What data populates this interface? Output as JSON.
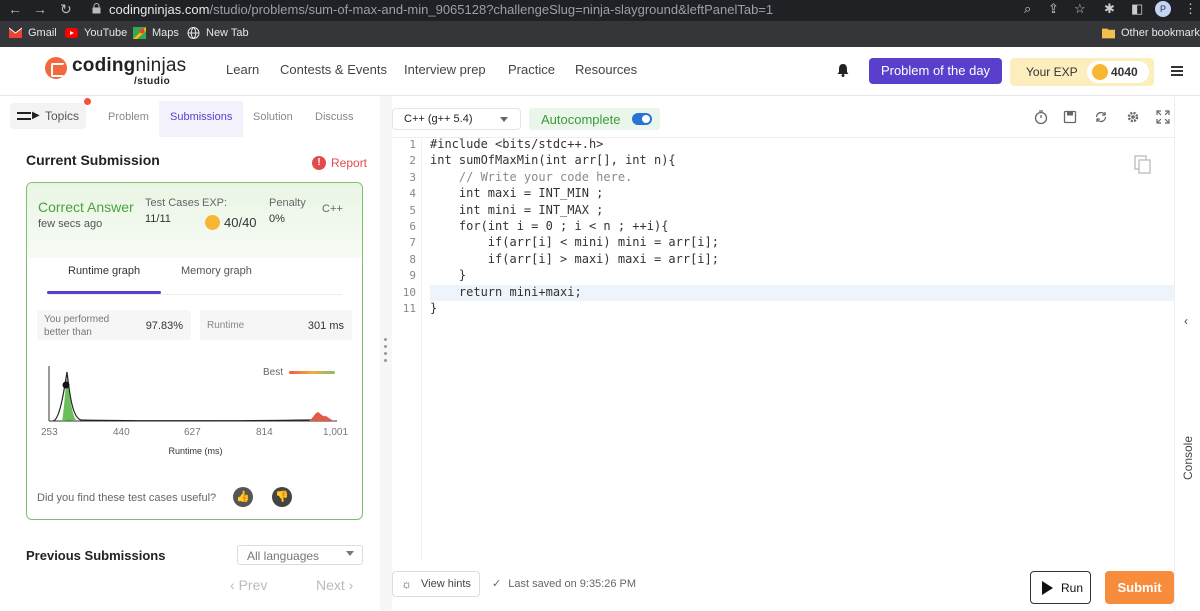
{
  "browser": {
    "url_host": "codingninjas.com",
    "url_path": "/studio/problems/sum-of-max-and-min_9065128?challengeSlug=ninja-slayground&leftPanelTab=1",
    "profile_initial": "P",
    "bookmarks": [
      "Gmail",
      "YouTube",
      "Maps",
      "New Tab"
    ],
    "other_bookmarks": "Other bookmarks"
  },
  "header": {
    "logo_main": "coding",
    "logo_ninjas": "ninjas",
    "logo_sub": "/studio",
    "nav": [
      "Learn",
      "Contests & Events",
      "Interview prep",
      "Practice",
      "Resources"
    ],
    "potd": "Problem of the day",
    "exp_label": "Your EXP",
    "exp_value": "4040"
  },
  "left": {
    "topics": "Topics",
    "tabs": [
      "Problem",
      "Submissions",
      "Solution",
      "Discuss"
    ],
    "current_submission": "Current Submission",
    "report": "Report",
    "status": "Correct Answer",
    "time_ago": "few secs ago",
    "test_cases_label": "Test Cases",
    "test_cases_value": "11/11",
    "exp_label": "EXP:",
    "exp_value": "40/40",
    "penalty_label": "Penalty",
    "penalty_value": "0%",
    "language": "C++",
    "graph_tabs": [
      "Runtime graph",
      "Memory graph"
    ],
    "performed_label": "You performed better than",
    "performed_value": "97.83%",
    "runtime_label": "Runtime",
    "runtime_value": "301 ms",
    "best_label": "Best",
    "x_ticks": [
      "253",
      "440",
      "627",
      "814",
      "1,001"
    ],
    "x_label": "Runtime (ms)",
    "useful_question": "Did you find these test cases useful?",
    "previous_submissions": "Previous Submissions",
    "all_languages": "All languages",
    "prev": "Prev",
    "next": "Next"
  },
  "editor": {
    "language": "C++ (g++ 5.4)",
    "autocomplete": "Autocomplete",
    "lines": [
      "#include <bits/stdc++.h>",
      "int sumOfMaxMin(int arr[], int n){",
      "    // Write your code here.",
      "    int maxi = INT_MIN ;",
      "    int mini = INT_MAX ;",
      "    for(int i = 0 ; i < n ; ++i){",
      "        if(arr[i] < mini) mini = arr[i];",
      "        if(arr[i] > maxi) maxi = arr[i];",
      "    }",
      "    return mini+maxi;",
      "}"
    ],
    "line_numbers": [
      "1",
      "2",
      "3",
      "4",
      "5",
      "6",
      "7",
      "8",
      "9",
      "10",
      "11"
    ],
    "view_hints": "View hints",
    "last_saved": "Last saved on 9:35:26 PM",
    "run": "Run",
    "submit": "Submit",
    "console": "Console"
  }
}
